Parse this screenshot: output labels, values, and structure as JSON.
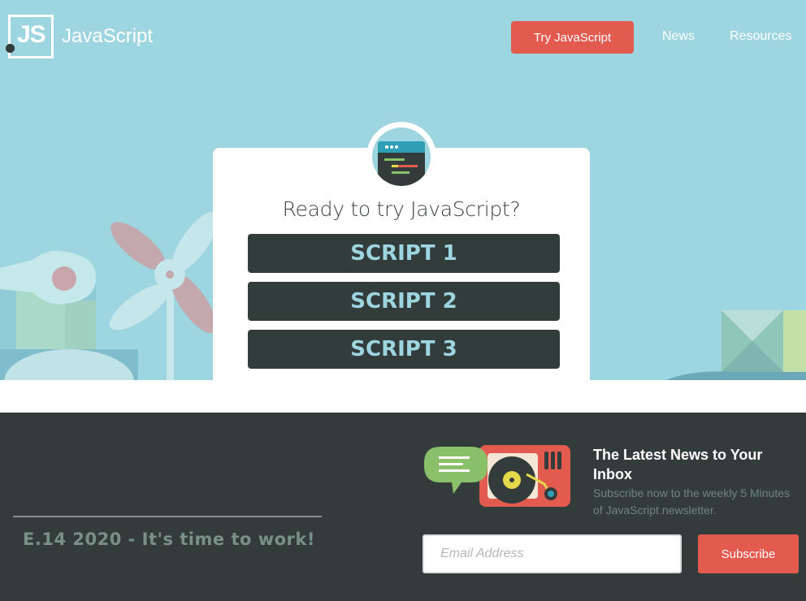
{
  "header": {
    "logo_mark": "JS",
    "logo_text": "JavaScript",
    "cta_label": "Try JavaScript",
    "nav": [
      "News",
      "Resources"
    ]
  },
  "hero": {
    "title": "Ready to try JavaScript?",
    "scripts": [
      "SCRIPT 1",
      "SCRIPT 2",
      "SCRIPT 3"
    ]
  },
  "footer": {
    "tagline": "E.14 2020 - It's time to work!",
    "news_title": "The Latest News to Your Inbox",
    "news_subtitle": "Subscribe now to the weekly 5 Minutes of JavaScript newsletter.",
    "email_placeholder": "Email Address",
    "subscribe_label": "Subscribe"
  },
  "colors": {
    "hero_bg": "#9dd5e0",
    "accent_red": "#e35a4f",
    "dark": "#333c3a",
    "script_text": "#9dd5e0"
  },
  "icons": [
    "code-window-icon",
    "chat-bubble-icon",
    "record-player-icon"
  ]
}
